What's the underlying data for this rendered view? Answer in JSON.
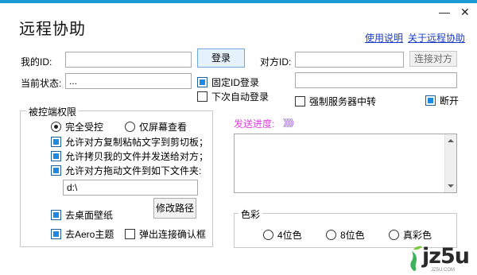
{
  "window": {
    "title": "远程协助",
    "minimize_glyph": "—",
    "close_glyph": "✕"
  },
  "header_links": {
    "help": "使用说明",
    "about": "关于远程协助"
  },
  "my_id": {
    "label": "我的ID:",
    "value": "",
    "login_button": "登录"
  },
  "status": {
    "label": "当前状态:",
    "value": "..."
  },
  "peer": {
    "label": "对方ID:",
    "value": "",
    "connect_button": "连接对方",
    "second_field_value": ""
  },
  "options": {
    "fixed_id": {
      "label": "固定ID登录",
      "checked": true
    },
    "auto_login": {
      "label": "下次自动登录",
      "checked": false
    },
    "force_relay": {
      "label": "强制服务器中转",
      "checked": false
    },
    "disconnect": {
      "label": "断开",
      "checked": true
    }
  },
  "permissions": {
    "legend": "被控端权限",
    "mode_full": {
      "label": "完全受控",
      "selected": true
    },
    "mode_view": {
      "label": "仅屏幕查看",
      "selected": false
    },
    "allow_copy_text": {
      "label": "允许对方复制粘帖文字到剪切板；",
      "checked": true
    },
    "allow_send_files": {
      "label": "允许拷贝我的文件并发送给对方；",
      "checked": true
    },
    "allow_drag_files": {
      "label": "允许对方拖动文件到如下文件夹:",
      "checked": true
    },
    "folder_path": "d:\\",
    "remove_wallpaper": {
      "label": "去桌面壁纸",
      "checked": true
    },
    "remove_aero": {
      "label": "去Aero主题",
      "checked": true
    },
    "popup_confirm": {
      "label": "弹出连接确认框",
      "checked": false
    },
    "change_path_button": "修改路径"
  },
  "progress": {
    "label": "发送进度:",
    "arrows": "》》》",
    "log_text": ""
  },
  "color": {
    "legend": "色彩",
    "bit4": {
      "label": "4位色",
      "selected": false
    },
    "bit8": {
      "label": "8位色",
      "selected": false
    },
    "truecolor": {
      "label": "真彩色",
      "selected": false
    }
  },
  "watermark": {
    "logo_text": "jz5u",
    "sub_text": "JZ5U.COM"
  },
  "colors": {
    "accent": "#1a9ad6",
    "link": "#1a3cc8",
    "progress_label": "#e040e0",
    "progress_arrows": "#8a3ce0"
  }
}
